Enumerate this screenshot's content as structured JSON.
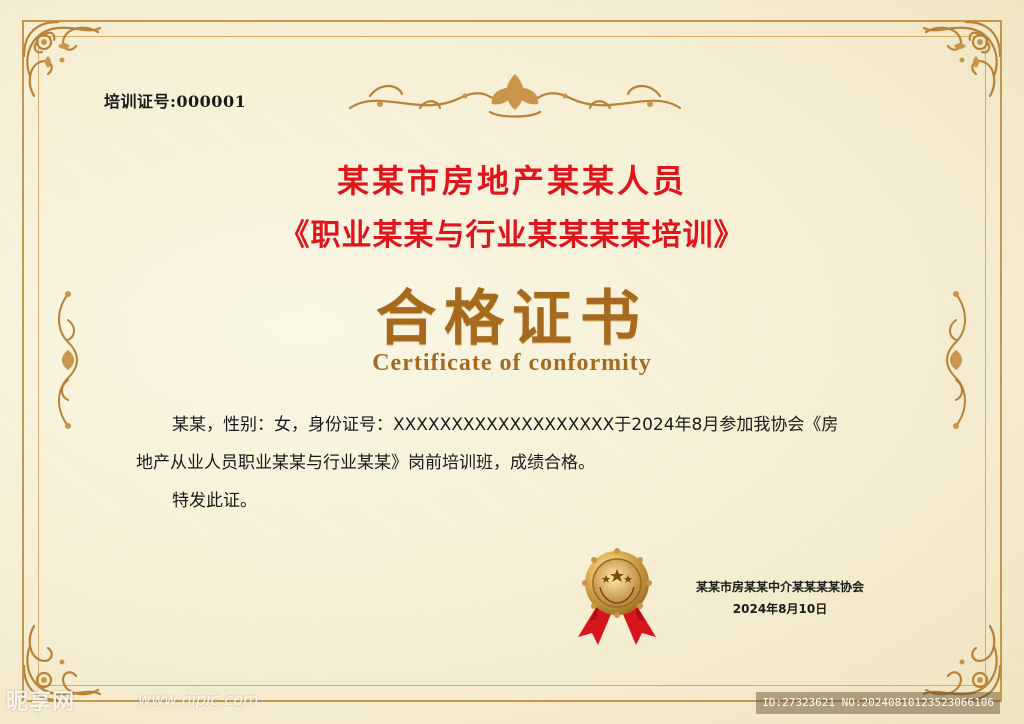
{
  "certificate": {
    "number_label": "培训证号:000001",
    "title_line1": "某某市房地产某某人员",
    "title_line2": "《职业某某与行业某某某某培训》",
    "main_title": "合格证书",
    "subtitle": "Certificate of conformity",
    "body_line1": "某某，性别：女，身份证号：XXXXXXXXXXXXXXXXXXX于2024年8月参加我协会《房",
    "body_line2": "地产从业人员职业某某与行业某某》岗前培训班，成绩合格。",
    "body_line3": "特发此证。",
    "issuer": "某某市房某某中介某某某某协会",
    "issue_date": "2024年8月10日"
  },
  "watermark": {
    "logo_text": "昵享网",
    "site": "www.nipic.com",
    "id_text": "ID:27323621 NO:20240810123523066106"
  },
  "colors": {
    "title_red": "#e0151c",
    "gold": "#a66a1f",
    "frame_gold": "#c9954a",
    "background": "#f6f1dc"
  },
  "icons": {
    "corner": "ornate-corner-icon",
    "top": "floral-crest-icon",
    "side": "scroll-ornament-icon",
    "seal": "gold-medal-seal-icon"
  }
}
